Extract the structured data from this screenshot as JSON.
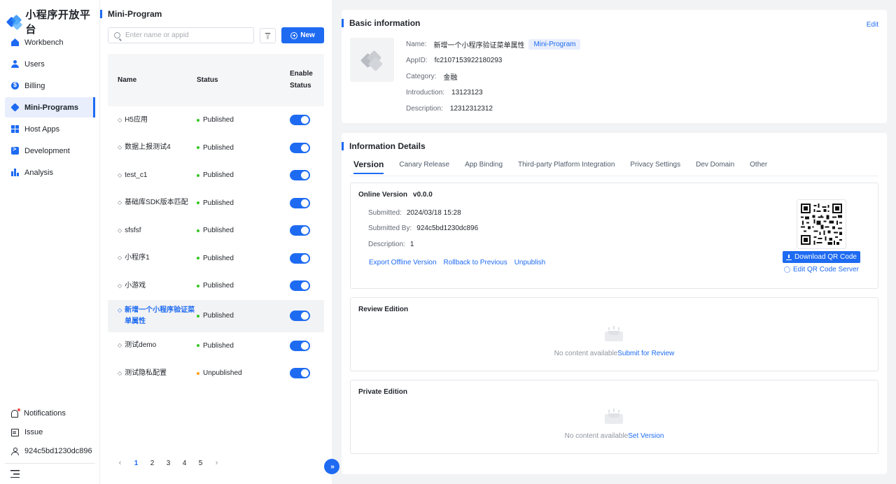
{
  "brand": {
    "name": "小程序开放平台"
  },
  "nav": [
    {
      "label": "Workbench",
      "icon": "home-icon"
    },
    {
      "label": "Users",
      "icon": "users-icon"
    },
    {
      "label": "Billing",
      "icon": "billing-icon"
    },
    {
      "label": "Mini-Programs",
      "icon": "mini-program-icon",
      "active": true
    },
    {
      "label": "Host Apps",
      "icon": "grid-icon"
    },
    {
      "label": "Development",
      "icon": "terminal-icon"
    },
    {
      "label": "Analysis",
      "icon": "bar-chart-icon"
    }
  ],
  "bottom_nav": {
    "notifications": "Notifications",
    "issue": "Issue",
    "user": "924c5bd1230dc896"
  },
  "list": {
    "title": "Mini-Program",
    "search_placeholder": "Enter name or appid",
    "new_label": "New",
    "headers": {
      "name": "Name",
      "status": "Status",
      "enable": "Enable Status"
    },
    "rows": [
      {
        "name": "H5应用",
        "status": "Published"
      },
      {
        "name": "数据上报测试4",
        "status": "Published"
      },
      {
        "name": "test_c1",
        "status": "Published"
      },
      {
        "name": "基础库SDK版本匹配",
        "status": "Published"
      },
      {
        "name": "sfsfsf",
        "status": "Published"
      },
      {
        "name": "小程序1",
        "status": "Published"
      },
      {
        "name": "小游戏",
        "status": "Published"
      },
      {
        "name": "新增一个小程序验证菜单属性",
        "status": "Published"
      },
      {
        "name": "测试demo",
        "status": "Published"
      },
      {
        "name": "测试隐私配置",
        "status": "Unpublished"
      }
    ],
    "pagination": {
      "pages": [
        "1",
        "2",
        "3",
        "4",
        "5"
      ],
      "current": "1",
      "prev": "‹",
      "next": "›"
    },
    "expand_glyph": "»"
  },
  "basic": {
    "title": "Basic information",
    "edit_label": "Edit",
    "name_label": "Name:",
    "name_value": "新增一个小程序验证菜单属性",
    "type_tag": "Mini-Program",
    "appid_label": "AppID:",
    "appid_value": "fc2107153922180293",
    "category_label": "Category:",
    "category_value": "金融",
    "intro_label": "Introduction:",
    "intro_value": "13123123",
    "desc_label": "Description:",
    "desc_value": "12312312312"
  },
  "details": {
    "title": "Information Details",
    "tabs": [
      "Version",
      "Canary Release",
      "App Binding",
      "Third-party Platform Integration",
      "Privacy Settings",
      "Dev Domain",
      "Other"
    ],
    "online": {
      "title": "Online Version",
      "version": "v0.0.0",
      "submitted_label": "Submitted:",
      "submitted_value": "2024/03/18 15:28",
      "submitted_by_label": "Submitted By:",
      "submitted_by_value": "924c5bd1230dc896",
      "description_label": "Description:",
      "description_value": "1",
      "actions": [
        "Export Offline Version",
        "Rollback to Previous",
        "Unpublish"
      ],
      "download_qr": "Download QR Code",
      "edit_qr": "Edit QR Code Server"
    },
    "review": {
      "title": "Review Edition",
      "empty": "No content available",
      "action": "Submit for Review"
    },
    "private": {
      "title": "Private Edition",
      "empty": "No content available",
      "action": "Set Version"
    }
  },
  "colors": {
    "accent": "#1e6bf2",
    "success": "#34c724",
    "warning": "#ffa216"
  }
}
